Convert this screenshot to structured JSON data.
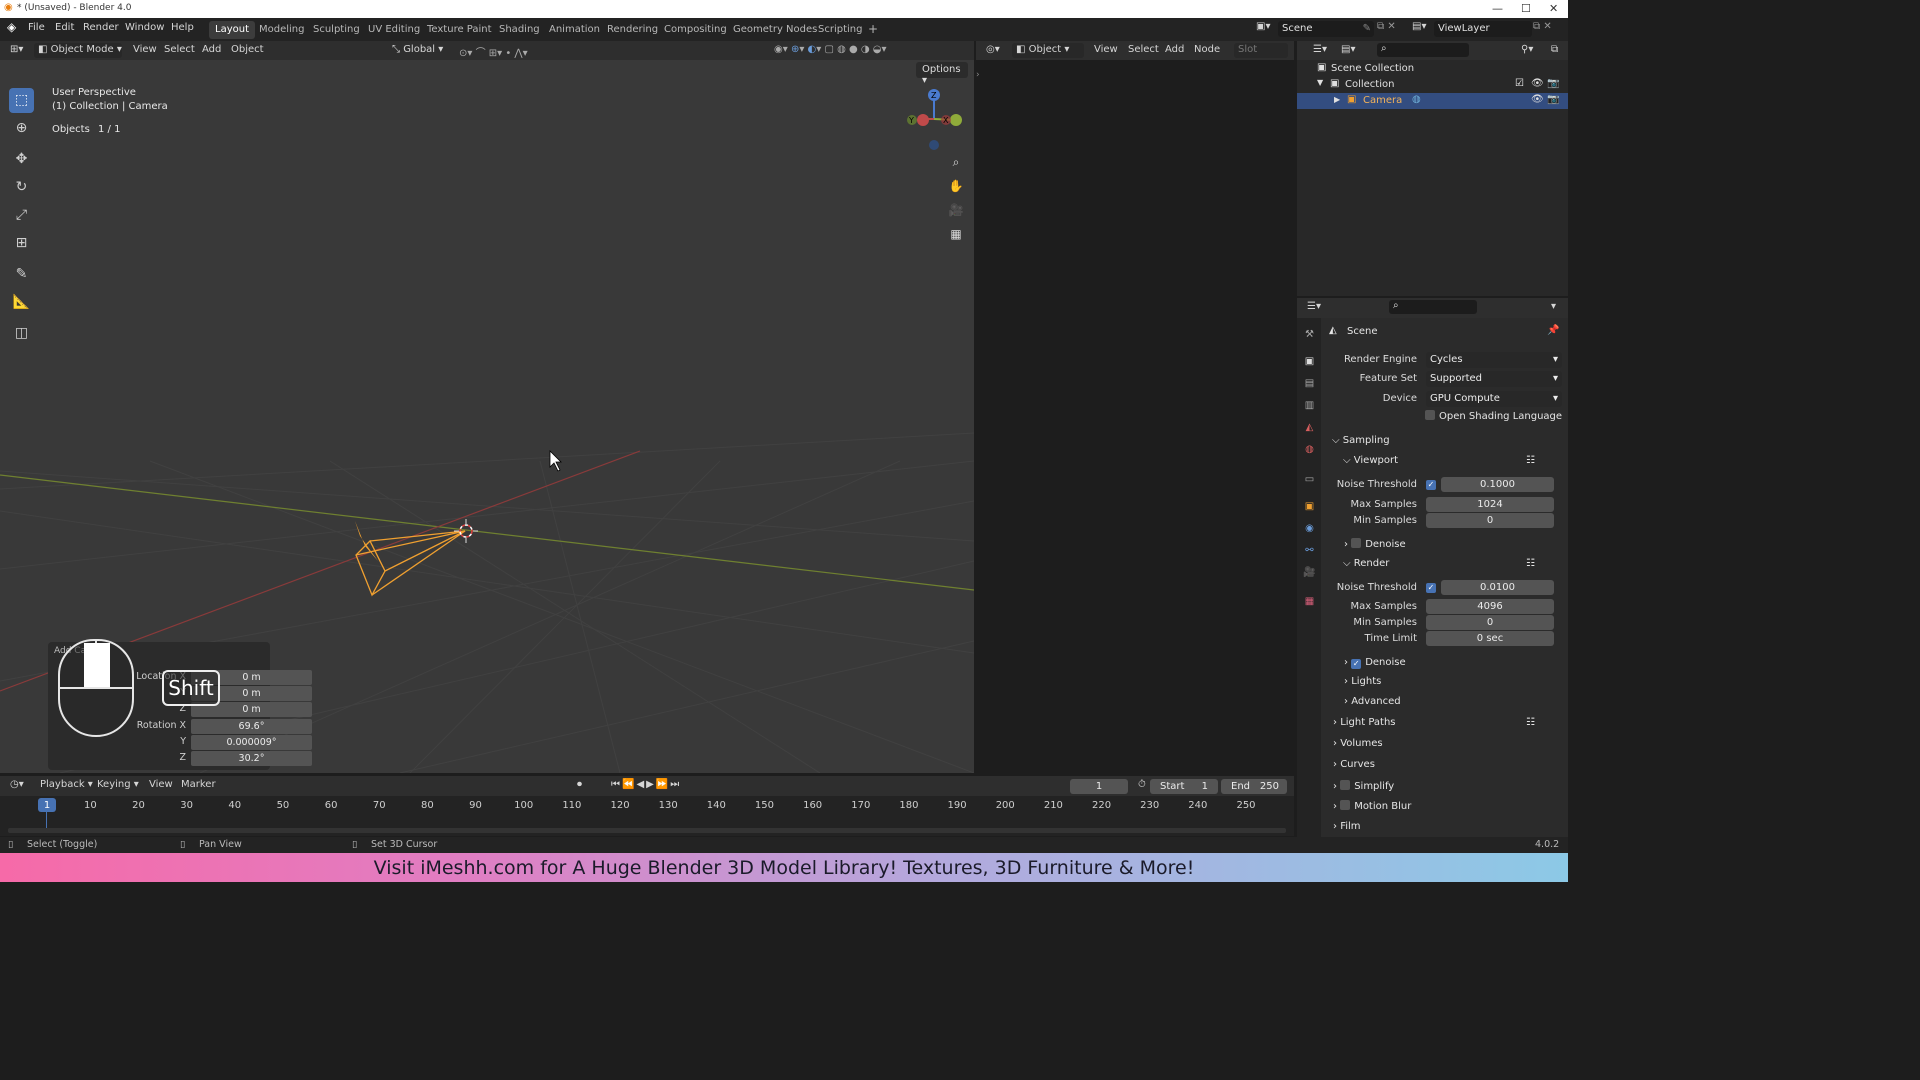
{
  "window": {
    "title": "* (Unsaved) - Blender 4.0",
    "min": "—",
    "max": "☐",
    "close": "✕"
  },
  "menus": [
    "File",
    "Edit",
    "Render",
    "Window",
    "Help"
  ],
  "workspaces": [
    "Layout",
    "Modeling",
    "Sculpting",
    "UV Editing",
    "Texture Paint",
    "Shading",
    "Animation",
    "Rendering",
    "Compositing",
    "Geometry Nodes",
    "Scripting"
  ],
  "active_workspace": "Layout",
  "add_workspace": "+",
  "scene": {
    "name": "Scene",
    "view_layer": "ViewLayer"
  },
  "viewport_header": {
    "mode": "Object Mode",
    "menus": [
      "View",
      "Select",
      "Add",
      "Object"
    ],
    "orientation": "Global",
    "options": "Options"
  },
  "viewport": {
    "perspective": "User Perspective",
    "collection": "(1) Collection | Camera",
    "objects_label": "Objects",
    "objects_value": "1 / 1"
  },
  "gizmo": {
    "z": "Z",
    "y": "Y",
    "x": "X"
  },
  "redo_panel": {
    "title": "Add Camera",
    "rows": [
      {
        "label": "Location X",
        "value": "0 m"
      },
      {
        "label": "Y",
        "value": "0 m"
      },
      {
        "label": "Z",
        "value": "0 m"
      },
      {
        "label": "Rotation X",
        "value": "69.6°"
      },
      {
        "label": "Y",
        "value": "0.000009°"
      },
      {
        "label": "Z",
        "value": "30.2°"
      }
    ]
  },
  "key_overlay": "Shift",
  "node_header": {
    "type": "Object",
    "menus": [
      "View",
      "Select",
      "Add",
      "Node"
    ],
    "slot": "Slot"
  },
  "outliner": {
    "rows": [
      {
        "label": "Scene Collection"
      },
      {
        "label": "Collection"
      },
      {
        "label": "Camera"
      }
    ]
  },
  "properties": {
    "context": "Scene",
    "render_engine": {
      "label": "Render Engine",
      "value": "Cycles"
    },
    "feature_set": {
      "label": "Feature Set",
      "value": "Supported"
    },
    "device": {
      "label": "Device",
      "value": "GPU Compute"
    },
    "osl": "Open Shading Language",
    "sampling": "Sampling",
    "viewport_section": "Viewport",
    "viewport_noise": {
      "label": "Noise Threshold",
      "value": "0.1000"
    },
    "viewport_max": {
      "label": "Max Samples",
      "value": "1024"
    },
    "viewport_min": {
      "label": "Min Samples",
      "value": "0"
    },
    "viewport_denoise": "Denoise",
    "render_section": "Render",
    "render_noise": {
      "label": "Noise Threshold",
      "value": "0.0100"
    },
    "render_max": {
      "label": "Max Samples",
      "value": "4096"
    },
    "render_min": {
      "label": "Min Samples",
      "value": "0"
    },
    "render_time": {
      "label": "Time Limit",
      "value": "0 sec"
    },
    "render_denoise": "Denoise",
    "lights": "Lights",
    "advanced": "Advanced",
    "light_paths": "Light Paths",
    "volumes": "Volumes",
    "curves": "Curves",
    "simplify": "Simplify",
    "motion_blur": "Motion Blur",
    "film": "Film"
  },
  "timeline": {
    "menus": [
      "Playback",
      "Keying",
      "View",
      "Marker"
    ],
    "current_frame": "1",
    "start_label": "Start",
    "start": "1",
    "end_label": "End",
    "end": "250",
    "ticks": [
      "1",
      "10",
      "20",
      "30",
      "40",
      "50",
      "60",
      "70",
      "80",
      "90",
      "100",
      "110",
      "120",
      "130",
      "140",
      "150",
      "160",
      "170",
      "180",
      "190",
      "200",
      "210",
      "220",
      "230",
      "240",
      "250"
    ]
  },
  "statusbar": {
    "select": "Select (Toggle)",
    "pan": "Pan View",
    "cursor": "Set 3D Cursor",
    "version": "4.0.2"
  },
  "banner": "Visit iMeshh.com for A Huge Blender 3D Model Library! Textures, 3D Furniture & More!",
  "colors": {
    "selection_blue": "#4772b3",
    "camera_orange": "#f0a030",
    "x_axis": "#c04a4a",
    "y_axis": "#8fab3a"
  }
}
